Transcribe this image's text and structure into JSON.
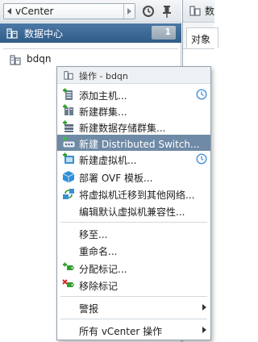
{
  "nav": {
    "back_label": "vCenter",
    "datacenter_label": "数据中心",
    "datacenter_badge": "1",
    "tree_item_label": "bdqn"
  },
  "main": {
    "title": "数",
    "tab_label": "对象"
  },
  "context_menu": {
    "header": "操作 - bdqn",
    "items": [
      {
        "label": "添加主机...",
        "icon": "add-host-icon",
        "clock": true
      },
      {
        "label": "新建群集...",
        "icon": "new-cluster-icon"
      },
      {
        "label": "新建数据存储群集...",
        "icon": "new-datastore-cluster-icon"
      },
      {
        "label": "新建 Distributed Switch...",
        "icon": "new-distributed-switch-icon",
        "active": true
      },
      {
        "label": "新建虚拟机...",
        "icon": "new-vm-icon",
        "clock": true
      },
      {
        "label": "部署 OVF 模板...",
        "icon": "deploy-ovf-icon"
      },
      {
        "label": "将虚拟机迁移到其他网络...",
        "icon": "migrate-network-icon"
      },
      {
        "label": "编辑默认虚拟机兼容性...",
        "icon": ""
      },
      {
        "label": "移至...",
        "icon": ""
      },
      {
        "label": "重命名...",
        "icon": ""
      },
      {
        "label": "分配标记...",
        "icon": "assign-tag-icon"
      },
      {
        "label": "移除标记",
        "icon": "remove-tag-icon"
      },
      {
        "label": "警报",
        "icon": "",
        "submenu": true
      },
      {
        "label": "所有 vCenter 操作",
        "icon": "",
        "submenu": true
      }
    ]
  },
  "colors": {
    "accent": "#3f6c98",
    "active_item": "#6f8aa6",
    "clock": "#4a90d9"
  }
}
